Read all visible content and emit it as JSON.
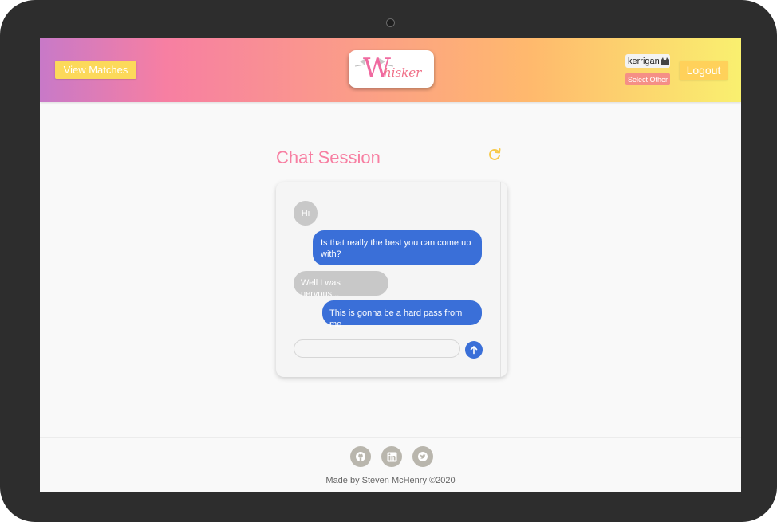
{
  "header": {
    "view_matches_label": "View Matches",
    "logo_initial": "W",
    "logo_rest": "hisker",
    "username": "kerrigan",
    "select_other_label": "Select Other",
    "logout_label": "Logout"
  },
  "chat": {
    "title": "Chat Session",
    "messages": [
      {
        "sender": "them",
        "text": "Hi"
      },
      {
        "sender": "me",
        "text": "Is that really the best you can come up with?"
      },
      {
        "sender": "them",
        "text": "Well I was nervous..."
      },
      {
        "sender": "me",
        "text": "This is gonna be a hard pass from me"
      }
    ],
    "input_value": "",
    "input_placeholder": ""
  },
  "footer": {
    "icons": [
      "github-icon",
      "linkedin-icon",
      "twitter-icon"
    ],
    "credit": "Made by Steven McHenry ©2020"
  },
  "colors": {
    "accent_pink": "#f77fa2",
    "button_yellow": "#fcd95a",
    "bubble_blue": "#3a6fd8",
    "bubble_gray": "#c8c8c8"
  }
}
